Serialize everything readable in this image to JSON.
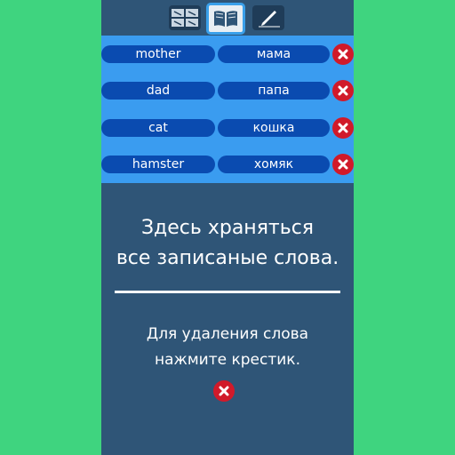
{
  "toolbar": {
    "tabs": [
      {
        "icon": "grid-icon",
        "active": false
      },
      {
        "icon": "book-icon",
        "active": true
      },
      {
        "icon": "pen-icon",
        "active": false
      }
    ]
  },
  "words": [
    {
      "word": "mother",
      "translation": "мама"
    },
    {
      "word": "dad",
      "translation": "папа"
    },
    {
      "word": "cat",
      "translation": "кошка"
    },
    {
      "word": "hamster",
      "translation": "хомяк"
    }
  ],
  "info": {
    "title": "Здесь храняться\nвсе записаные слова.",
    "hint": "Для удаления слова\nнажмите крестик."
  },
  "colors": {
    "background": "#3fd47f",
    "panel": "#2f5577",
    "list_background": "#3a9cf0",
    "pill": "#0a4bb0",
    "delete": "#d11a2a"
  }
}
